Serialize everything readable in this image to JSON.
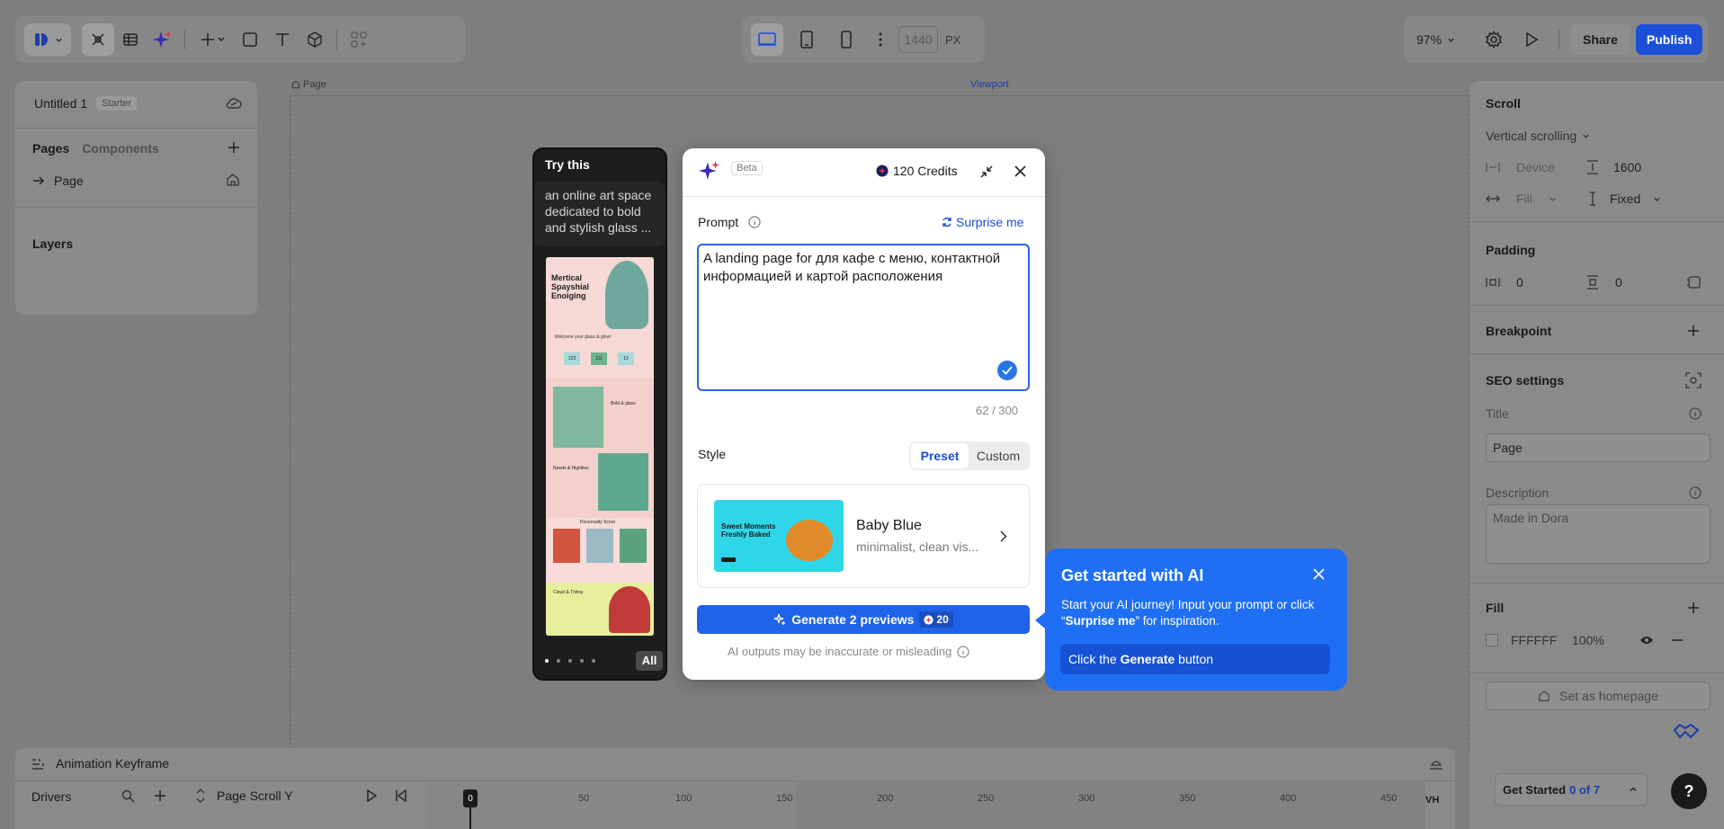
{
  "toolbar": {
    "viewport_width": "1440",
    "unit": "PX",
    "zoom": "97%",
    "share_label": "Share",
    "publish_label": "Publish"
  },
  "canvas": {
    "page_label": "Page",
    "viewport_label": "Viewport"
  },
  "left_panel": {
    "project_name": "Untitled 1",
    "plan_badge": "Starter",
    "tabs": [
      "Pages",
      "Components"
    ],
    "page_item": "Page",
    "layers_title": "Layers"
  },
  "right_panel": {
    "scroll_title": "Scroll",
    "scroll_mode": "Vertical scrolling",
    "device_label": "Device",
    "height_value": "1600",
    "fill_label": "Fill",
    "fixed_label": "Fixed",
    "padding_title": "Padding",
    "padding_h": "0",
    "padding_v": "0",
    "breakpoint_title": "Breakpoint",
    "seo_title": "SEO settings",
    "title_label": "Title",
    "title_value": "Page",
    "description_label": "Description",
    "description_value": "Made in Dora",
    "fill_title": "Fill",
    "fill_color": "FFFFFF",
    "fill_opacity": "100%",
    "set_homepage": "Set as homepage",
    "get_started": "Get Started",
    "get_started_progress": "0 of 7"
  },
  "timeline": {
    "title": "Animation Keyframe",
    "drivers_label": "Drivers",
    "driver": "Page Scroll Y",
    "playhead": "0",
    "ticks": [
      "50",
      "100",
      "150",
      "200",
      "250",
      "300",
      "350",
      "400",
      "450"
    ],
    "unit": "VH"
  },
  "try_this": {
    "title": "Try this",
    "prompt": "an online art space dedicated to bold and stylish glass ...",
    "all_label": "All",
    "preview_texts": [
      "Mertical Spayshial Enoiging",
      "Welcome your glass & glow!",
      "123",
      "111",
      "12",
      "Bold & glass",
      "Needs & Highlites",
      "Personality Score",
      "Cloud & Tnitng"
    ]
  },
  "dialog": {
    "beta": "Beta",
    "credits": "120 Credits",
    "prompt_label": "Prompt",
    "surprise_label": "Surprise me",
    "prompt_text": "A landing page for для кафе с меню, контактной информацией и картой расположения",
    "counter": "62 / 300",
    "style_label": "Style",
    "style_tabs": [
      "Preset",
      "Custom"
    ],
    "style_name": "Baby Blue",
    "style_desc": "minimalist, clean vis...",
    "thumb_title": "Sweet Moments Freshly Baked",
    "generate_label": "Generate 2 previews",
    "generate_cost": "20",
    "disclaimer": "AI outputs may be inaccurate or misleading"
  },
  "tip": {
    "title": "Get started with AI",
    "body_prefix": "Start your AI journey! Input your prompt or click “",
    "body_bold": "Surprise me",
    "body_suffix": "” for inspiration.",
    "action_prefix": "Click the ",
    "action_bold": "Generate",
    "action_suffix": " button"
  },
  "colors": {
    "accent": "#1c4fd8",
    "tip_blue": "#1f6ff5"
  }
}
